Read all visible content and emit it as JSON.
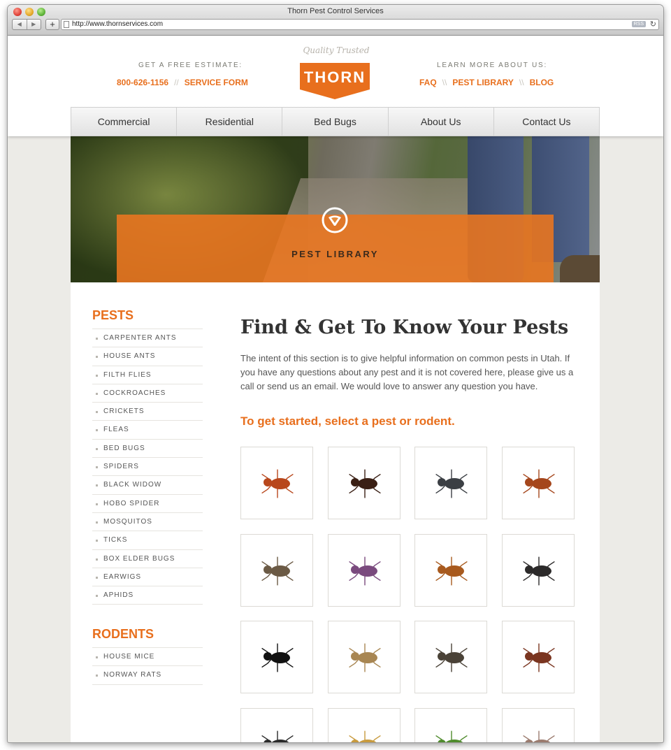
{
  "browser": {
    "window_title": "Thorn Pest Control Services",
    "url": "http://www.thornservices.com",
    "rss_label": "RSS",
    "back_glyph": "◀",
    "forward_glyph": "▶",
    "add_glyph": "+",
    "reload_glyph": "↻"
  },
  "header": {
    "estimate_label": "GET A FREE ESTIMATE:",
    "phone": "800-626-1156",
    "sep1": "//",
    "service_form": "SERVICE FORM",
    "learn_label": "LEARN MORE ABOUT US:",
    "faq": "FAQ",
    "sep2": "\\\\",
    "pest_library": "PEST LIBRARY",
    "sep3": "\\\\",
    "blog": "BLOG",
    "tagline": "Quality Trusted",
    "logo_text": "THORN"
  },
  "nav": {
    "items": [
      "Commercial",
      "Residential",
      "Bed Bugs",
      "About Us",
      "Contact Us"
    ]
  },
  "hero": {
    "title": "PEST LIBRARY",
    "icon": "thorn-pin-icon"
  },
  "sidebar": {
    "pests_heading": "PESTS",
    "pests": [
      "CARPENTER ANTS",
      "HOUSE ANTS",
      "FILTH FLIES",
      "COCKROACHES",
      "CRICKETS",
      "FLEAS",
      "BED BUGS",
      "SPIDERS",
      "BLACK WIDOW",
      "HOBO SPIDER",
      "MOSQUITOS",
      "TICKS",
      "BOX ELDER BUGS",
      "EARWIGS",
      "APHIDS"
    ],
    "rodents_heading": "RODENTS",
    "rodents": [
      "HOUSE MICE",
      "NORWAY RATS"
    ]
  },
  "main": {
    "title": "Find & Get To Know Your Pests",
    "intro": "The intent of this section is to give helpful information on common pests in Utah. If you have any questions about any pest and it is not covered here, please give us a call or send us an email. We would love to answer any question you have.",
    "cta": "To get started, select a pest or rodent."
  },
  "tiles": [
    {
      "icon": "carpenter-ant-icon",
      "color": "#b8471c"
    },
    {
      "icon": "house-ant-icon",
      "color": "#3a1f14"
    },
    {
      "icon": "fly-icon",
      "color": "#3b3f44"
    },
    {
      "icon": "cockroach-icon",
      "color": "#a5461c"
    },
    {
      "icon": "cricket-icon",
      "color": "#6b5a45"
    },
    {
      "icon": "flea-icon",
      "color": "#7a4a7e"
    },
    {
      "icon": "bed-bug-icon",
      "color": "#a85a1e"
    },
    {
      "icon": "jumping-spider-icon",
      "color": "#2c2a2a"
    },
    {
      "icon": "black-widow-icon",
      "color": "#111111"
    },
    {
      "icon": "hobo-spider-icon",
      "color": "#a88652"
    },
    {
      "icon": "mosquito-icon",
      "color": "#4a4237"
    },
    {
      "icon": "tick-icon",
      "color": "#7a3520"
    },
    {
      "icon": "box-elder-bug-icon",
      "color": "#2a2a2a"
    },
    {
      "icon": "earwig-icon",
      "color": "#c89a3d"
    },
    {
      "icon": "aphid-icon",
      "color": "#4f8b2c"
    },
    {
      "icon": "mouse-icon",
      "color": "#9b7b6e"
    }
  ],
  "colors": {
    "accent": "#e86f1d"
  }
}
